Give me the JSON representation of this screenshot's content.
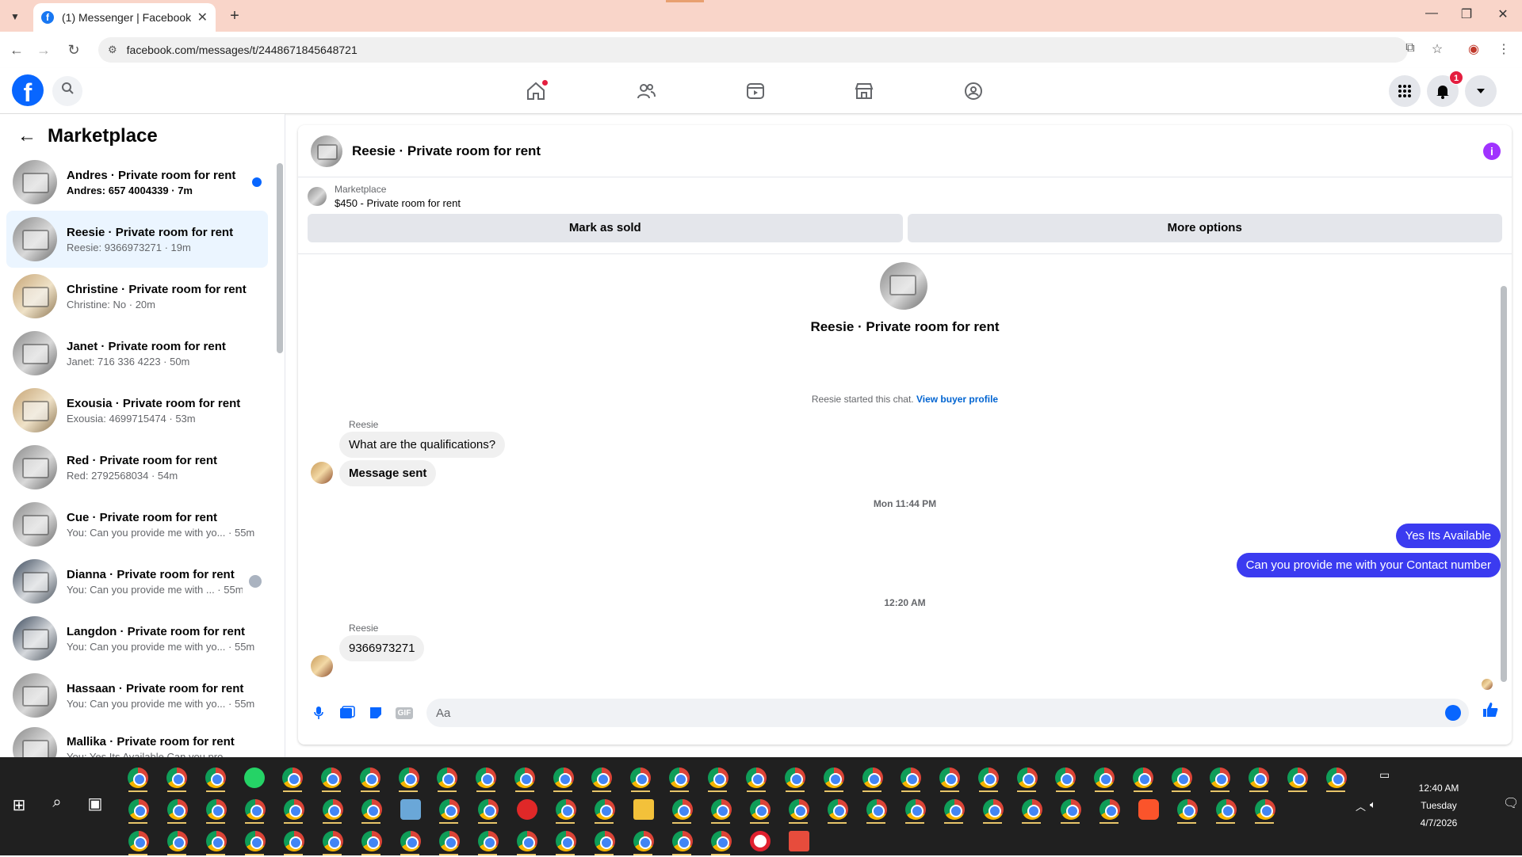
{
  "browser": {
    "tab_title": "(1) Messenger | Facebook",
    "favicon_letter": "f",
    "close_glyph": "✕",
    "newtab_glyph": "+",
    "url": "facebook.com/messages/t/2448671845648721",
    "win_min": "—",
    "win_max": "❐",
    "win_close": "✕"
  },
  "fbnav": {
    "logo_letter": "f",
    "notifications_count": "1"
  },
  "sidebar": {
    "title": "Marketplace",
    "conversations": [
      {
        "name": "Andres · Private room for rent",
        "preview": "Andres: 657 4004339 · 7m"
      },
      {
        "name": "Reesie · Private room for rent",
        "preview": "Reesie: 9366973271 · 19m"
      },
      {
        "name": "Christine · Private room for rent",
        "preview": "Christine: No · 20m"
      },
      {
        "name": "Janet · Private room for rent",
        "preview": "Janet: 716 336 4223 · 50m"
      },
      {
        "name": "Exousia · Private room for rent",
        "preview": "Exousia: 4699715474 · 53m"
      },
      {
        "name": "Red · Private room for rent",
        "preview": "Red: 2792568034 · 54m"
      },
      {
        "name": "Cue · Private room for rent",
        "preview": "You: Can you provide me with yo... · 55m"
      },
      {
        "name": "Dianna · Private room for rent",
        "preview": "You: Can you provide me with ... · 55m"
      },
      {
        "name": "Langdon · Private room for rent",
        "preview": "You: Can you provide me with yo... · 55m"
      },
      {
        "name": "Hassaan · Private room for rent",
        "preview": "You: Can you provide me with yo... · 55m"
      },
      {
        "name": "Mallika · Private room for rent",
        "preview": "You: Yes Its Available Can you pro..."
      }
    ]
  },
  "chat": {
    "title": "Reesie · Private room for rent",
    "info_glyph": "i",
    "marketplace_label": "Marketplace",
    "listing": "$450 - Private room for rent",
    "mark_sold": "Mark as sold",
    "more_options": "More options",
    "thread_name": "Reesie · Private room for rent",
    "started_text": "Reesie started this chat.",
    "view_profile": "View buyer profile",
    "sender1": "Reesie",
    "msg1": "What are the qualifications?",
    "msg2": "Message sent",
    "ts1": "Mon 11:44 PM",
    "out1": "Yes Its Available",
    "out2": "Can you provide me with your Contact number",
    "ts2": "12:20 AM",
    "sender2": "Reesie",
    "msg3": "9366973271",
    "placeholder": "Aa",
    "gif_label": "GIF"
  },
  "taskbar": {
    "time": "12:40 AM",
    "day": "Tuesday",
    "date": "4/7/2026"
  },
  "colors": {
    "accent": "#0866ff",
    "outgoing_bubble": "#3b3bf0",
    "tab_strip": "#f9d5c9",
    "taskbar": "#202020"
  }
}
